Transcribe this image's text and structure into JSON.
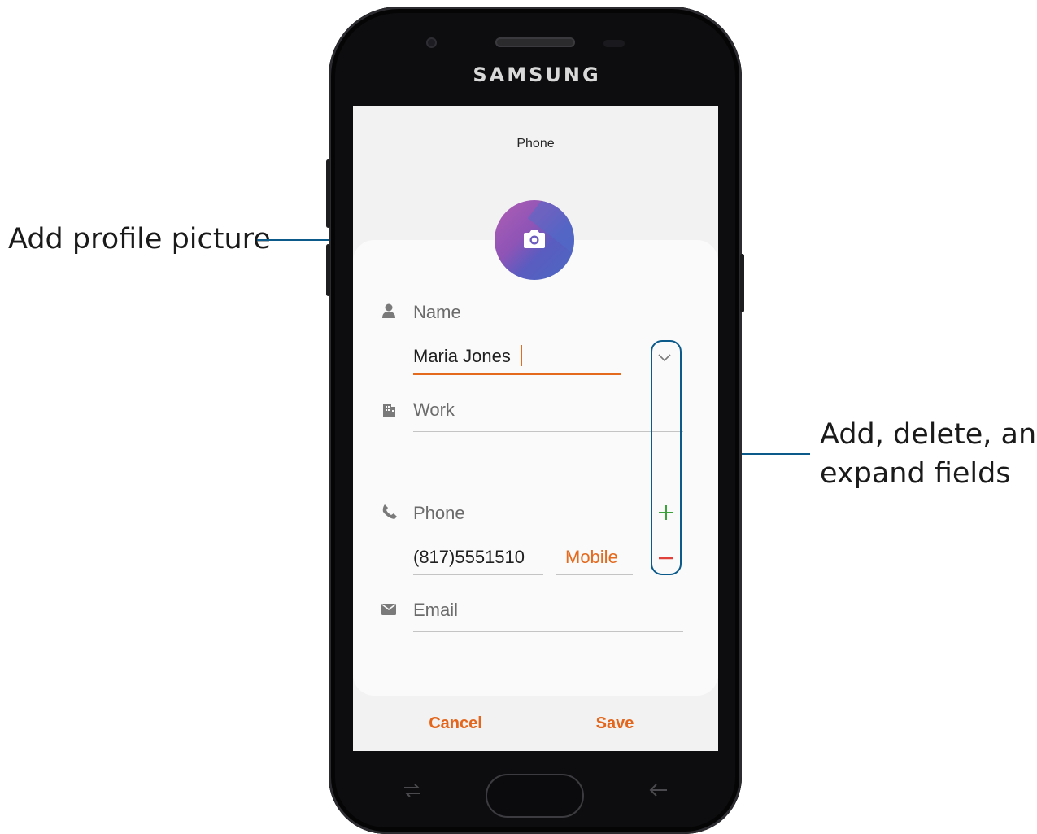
{
  "callouts": {
    "profile_picture": "Add profile picture",
    "fields_line1": "Add, delete, and",
    "fields_line2": "expand fields"
  },
  "device": {
    "brand": "SAMSUNG"
  },
  "screen": {
    "title": "Phone",
    "profile_icon": "camera-icon",
    "name": {
      "label": "Name",
      "value": "Maria Jones",
      "icon": "person-icon",
      "expand_icon": "chevron-down-icon"
    },
    "organization": {
      "label": "Work",
      "icon": "building-icon"
    },
    "phone": {
      "label": "Phone",
      "value": "(817)5551510",
      "type": "Mobile",
      "icon": "phone-icon",
      "add_icon": "plus-icon",
      "remove_icon": "minus-icon"
    },
    "email": {
      "label": "Email",
      "icon": "envelope-icon"
    },
    "actions": {
      "cancel": "Cancel",
      "save": "Save"
    }
  },
  "colors": {
    "accent": "#e46a1e",
    "add_green": "#3aa33a",
    "remove_red": "#e0413a",
    "callout_blue": "#0b5a8a"
  }
}
